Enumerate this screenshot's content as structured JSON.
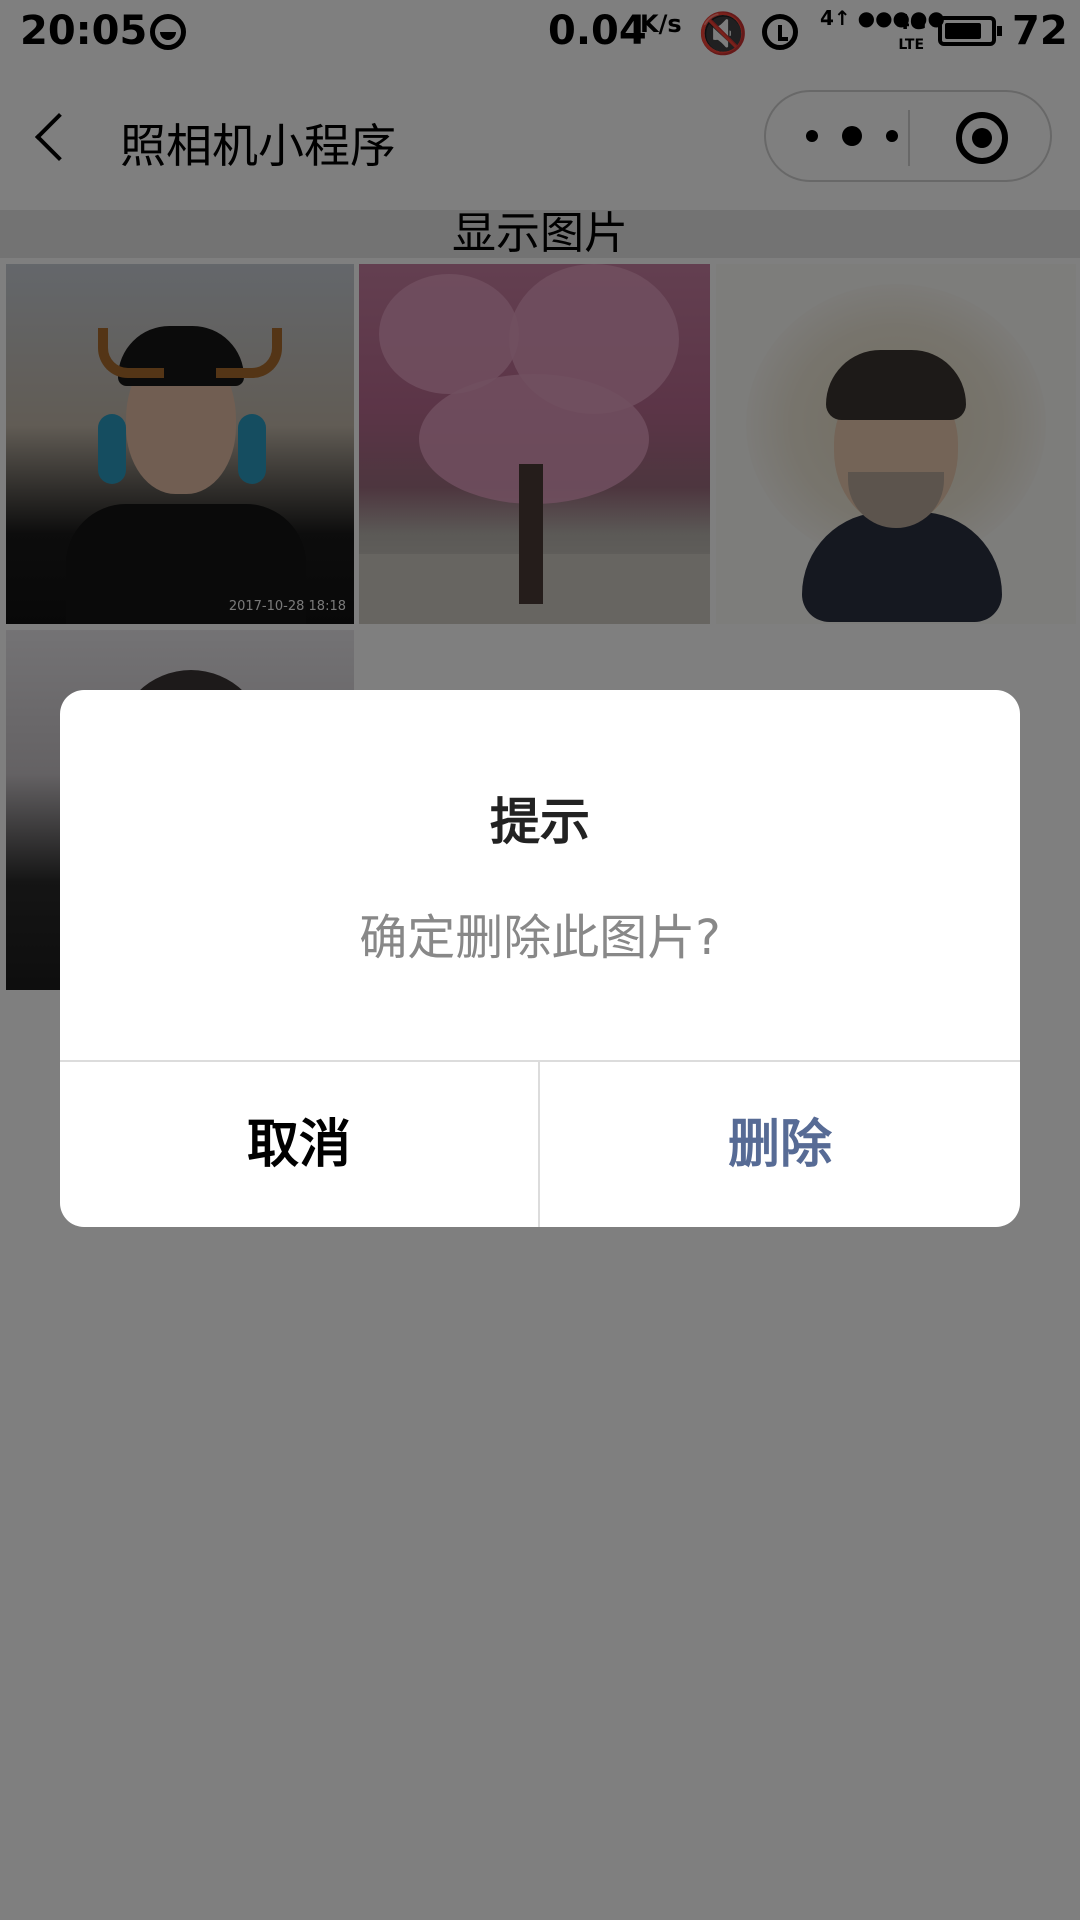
{
  "status_bar": {
    "time": "20:05",
    "net_speed": "0.04",
    "net_speed_unit": "K/s",
    "signal": "4↑ ●●●●●",
    "network_type": "4G",
    "network_sub": "LTE",
    "battery": "72",
    "battery_level_pct": 72,
    "icons": [
      "emoji-status-icon",
      "mute-icon",
      "alarm-icon",
      "signal-icon",
      "battery-icon"
    ]
  },
  "nav": {
    "title": "照相机小程序",
    "icons": [
      "back-icon",
      "more-icon",
      "close-icon"
    ]
  },
  "section": {
    "header": "显示图片"
  },
  "photos": [
    {
      "name": "photo-selfie",
      "timestamp": "2017-10-28 18:18"
    },
    {
      "name": "photo-cherry-blossom"
    },
    {
      "name": "photo-cartoon-portrait"
    },
    {
      "name": "photo-indoor"
    }
  ],
  "modal": {
    "title": "提示",
    "content": "确定删除此图片?",
    "cancel_label": "取消",
    "confirm_label": "删除",
    "confirm_color": "#576b95",
    "cancel_color": "#000000"
  },
  "colors": {
    "mask": "rgba(0,0,0,0.5)",
    "section_header_bg": "#e6e6e6"
  }
}
